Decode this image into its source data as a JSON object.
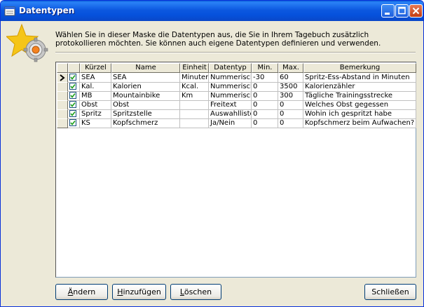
{
  "window": {
    "title": "Datentypen",
    "controls": [
      "minimize-icon",
      "maximize-icon",
      "close-icon"
    ]
  },
  "intro": {
    "text": "Wählen Sie in dieser Maske die Datentypen aus, die Sie in Ihrem Tagebuch zusätzlich protokollieren möchten. Sie können auch eigene Datentypen definieren und verwenden.",
    "icon": "star-gear-icon"
  },
  "table": {
    "columns": [
      "Kürzel",
      "Name",
      "Einheit",
      "Datentyp",
      "Min.",
      "Max.",
      "Bemerkung"
    ],
    "rows": [
      {
        "checked": true,
        "current": true,
        "kuerzel": "SEA",
        "name": "SEA",
        "einheit": "Minuten",
        "datentyp": "Nummerisch",
        "min": "-30",
        "max": "60",
        "bemerkung": "Spritz-Ess-Abstand in Minuten"
      },
      {
        "checked": true,
        "current": false,
        "kuerzel": "Kal.",
        "name": "Kalorien",
        "einheit": "Kcal.",
        "datentyp": "Nummerisch",
        "min": "0",
        "max": "3500",
        "bemerkung": "Kalorienzähler"
      },
      {
        "checked": true,
        "current": false,
        "kuerzel": "MB",
        "name": "Mountainbike",
        "einheit": "Km",
        "datentyp": "Nummerisch",
        "min": "0",
        "max": "300",
        "bemerkung": "Tägliche Trainingsstrecke"
      },
      {
        "checked": true,
        "current": false,
        "kuerzel": "Obst",
        "name": "Obst",
        "einheit": "",
        "datentyp": "Freitext",
        "min": "0",
        "max": "0",
        "bemerkung": "Welches Obst gegessen"
      },
      {
        "checked": true,
        "current": false,
        "kuerzel": "Spritz",
        "name": "Spritzstelle",
        "einheit": "",
        "datentyp": "Auswahlliste",
        "min": "0",
        "max": "0",
        "bemerkung": "Wohin ich gespritzt habe"
      },
      {
        "checked": true,
        "current": false,
        "kuerzel": "KS",
        "name": "Kopfschmerz",
        "einheit": "",
        "datentyp": "Ja/Nein",
        "min": "0",
        "max": "0",
        "bemerkung": "Kopfschmerz beim Aufwachen?"
      }
    ]
  },
  "buttons": {
    "aendern": {
      "before": "",
      "accel": "Ä",
      "after": "ndern"
    },
    "hinzufuegen": {
      "before": "",
      "accel": "H",
      "after": "inzufügen"
    },
    "loeschen": {
      "before": "",
      "accel": "L",
      "after": "öschen"
    },
    "schliessen": "Schließen"
  },
  "colors": {
    "titlebar": "#0a5fd8",
    "dialog_bg": "#ece9d8",
    "grid_lines": "#c0c0c0",
    "check": "#21a121"
  }
}
